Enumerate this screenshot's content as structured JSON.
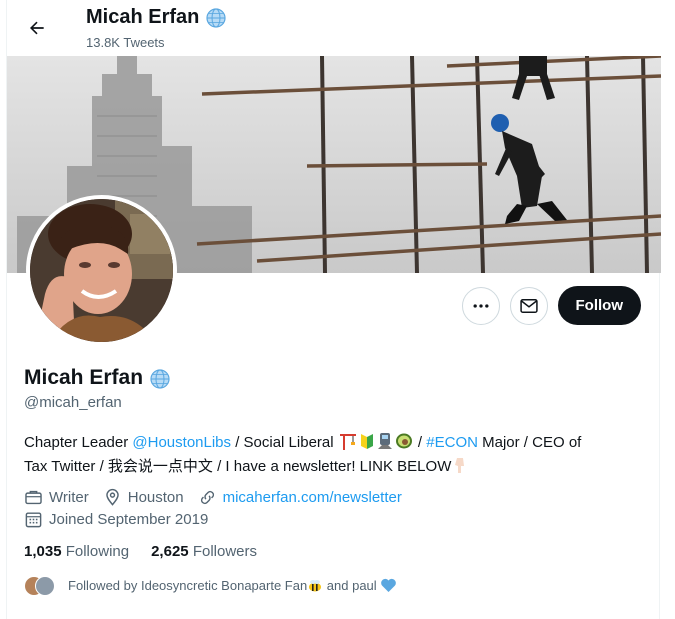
{
  "header": {
    "back_icon": "arrow-left-icon",
    "name": "Micah Erfan",
    "tweet_count": "13.8K Tweets"
  },
  "profile": {
    "name": "Micah Erfan",
    "handle": "@micah_erfan",
    "badge_icon": "globe-emoji-icon",
    "bio": {
      "t1": "Chapter Leader ",
      "mention": "@HoustonLibs",
      "t2": " / Social Liberal ",
      "t3": " / ",
      "hashtag": "#ECON",
      "t4": " Major / CEO of",
      "t5": "Tax Twitter / 我会说一点中文 / I have a newsletter! LINK BELOW"
    },
    "bio_emojis": [
      "construction-crane-emoji",
      "beginner-badge-emoji",
      "train-emoji",
      "avocado-emoji",
      "pointing-down-emoji"
    ],
    "occupation": "Writer",
    "location": "Houston",
    "website": "micaherfan.com/newsletter",
    "joined": "Joined September 2019",
    "following_count": "1,035",
    "following_label": "Following",
    "followers_count": "2,625",
    "followers_label": "Followers",
    "followed_by": {
      "t1": "Followed by Ideosyncretic Bonaparte Fan",
      "t2": " and paul"
    }
  },
  "actions": {
    "more_icon": "more-options-icon",
    "message_icon": "envelope-icon",
    "follow_label": "Follow"
  },
  "colors": {
    "accent": "#1d9bf0",
    "text": "#0f1419",
    "secondary": "#536471",
    "follow_button": "#0f1419"
  }
}
